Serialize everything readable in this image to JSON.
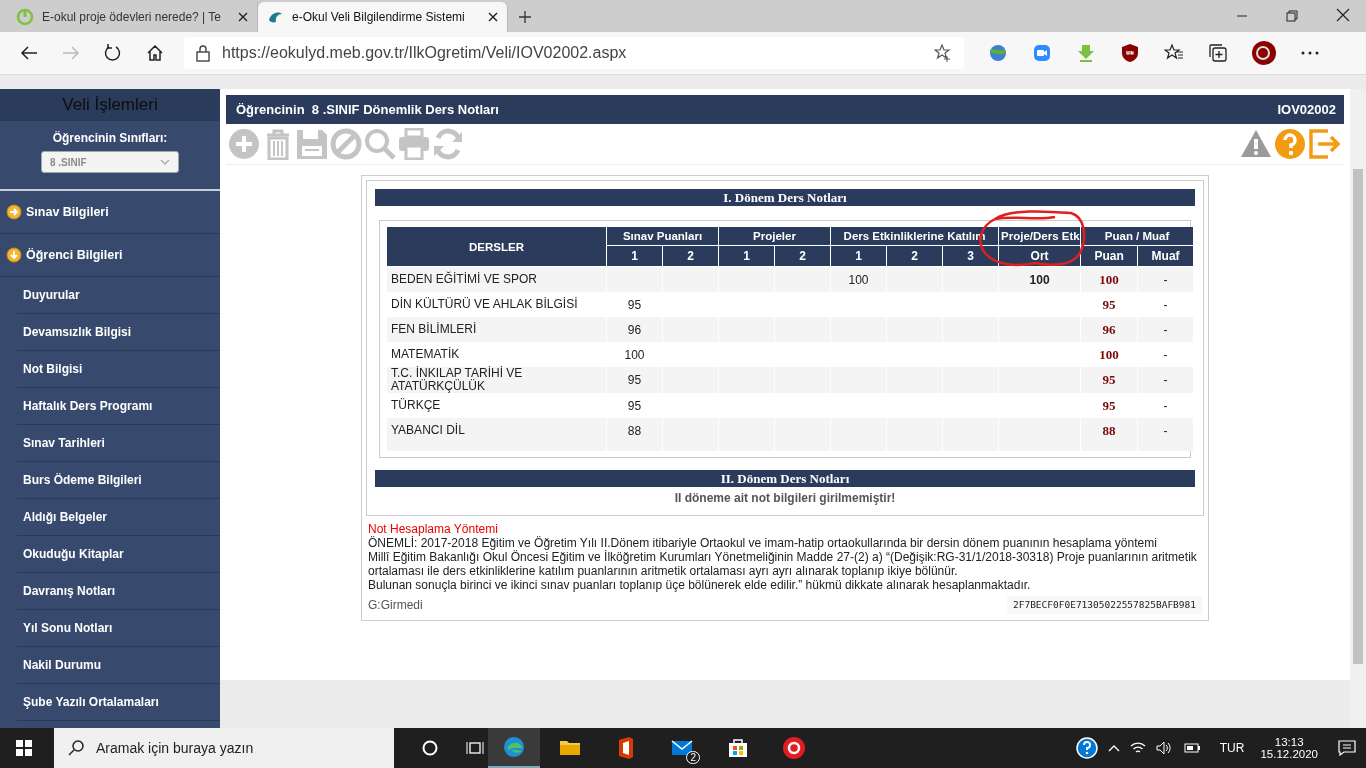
{
  "browser": {
    "tabs": [
      {
        "title": "E-okul proje ödevleri nerede? | Te",
        "selected": false
      },
      {
        "title": "e-Okul Veli Bilgilendirme Sistemi",
        "selected": true
      }
    ],
    "url": "https://eokulyd.meb.gov.tr/IlkOgretim/Veli/IOV02002.aspx"
  },
  "sidebar": {
    "title": "Veli İşlemleri",
    "class_label": "Öğrencinin Sınıfları:",
    "class_select": {
      "value": "8 .SINIF",
      "disabled": true
    },
    "items": [
      {
        "label": "Sınav Bilgileri",
        "kind": "section",
        "expanded": false
      },
      {
        "label": "Öğrenci Bilgileri",
        "kind": "section",
        "expanded": true
      },
      {
        "label": "Duyurular",
        "kind": "link"
      },
      {
        "label": "Devamsızlık Bilgisi",
        "kind": "link"
      },
      {
        "label": "Not Bilgisi",
        "kind": "link"
      },
      {
        "label": "Haftalık Ders Programı",
        "kind": "link"
      },
      {
        "label": "Sınav Tarihleri",
        "kind": "link"
      },
      {
        "label": "Burs Ödeme Bilgileri",
        "kind": "link"
      },
      {
        "label": "Aldığı Belgeler",
        "kind": "link"
      },
      {
        "label": "Okuduğu Kitaplar",
        "kind": "link"
      },
      {
        "label": "Davranış Notları",
        "kind": "link"
      },
      {
        "label": "Yıl Sonu Notları",
        "kind": "link"
      },
      {
        "label": "Nakil Durumu",
        "kind": "link"
      },
      {
        "label": "Şube Yazılı Ortalamaları",
        "kind": "link"
      }
    ]
  },
  "page": {
    "title": "Öğrencinin  8 .SINIF Dönemlik Ders Notları",
    "code": "IOV02002"
  },
  "term1": {
    "title": "I. Dönem Ders Notları",
    "groups": [
      "DERSLER",
      "Sınav Puanları",
      "Projeler",
      "Ders Etkinliklerine Katılım",
      "Proje/Ders Etk",
      "Puan / Muaf"
    ],
    "subheaders": [
      "1",
      "2",
      "1",
      "2",
      "1",
      "2",
      "3",
      "Ort",
      "Puan",
      "Muaf"
    ],
    "rows": [
      {
        "course": "BEDEN EĞİTİMİ VE SPOR",
        "activity_1": "100",
        "average": "100",
        "puan": "100",
        "muaf": "-"
      },
      {
        "course": "DİN KÜLTÜRÜ VE AHLAK BİLGİSİ",
        "exam_1": "95",
        "puan": "95",
        "muaf": "-"
      },
      {
        "course": "FEN BİLİMLERİ",
        "exam_1": "96",
        "puan": "96",
        "muaf": "-"
      },
      {
        "course": "MATEMATİK",
        "exam_1": "100",
        "puan": "100",
        "muaf": "-"
      },
      {
        "course": "T.C. İNKILAP TARİHİ VE ATATÜRKÇÜLÜK",
        "exam_1": "95",
        "puan": "95",
        "muaf": "-"
      },
      {
        "course": "TÜRKÇE",
        "exam_1": "95",
        "puan": "95",
        "muaf": "-"
      },
      {
        "course": "YABANCI DİL",
        "exam_1": "88",
        "puan": "88",
        "muaf": "-"
      }
    ]
  },
  "term2": {
    "title": "II. Dönem Ders Notları",
    "message": "II döneme ait not bilgileri girilmemiştir!"
  },
  "notes": {
    "heading": "Not Hesaplama Yöntemi",
    "lines": [
      "ÖNEMLİ: 2017-2018 Eğitim ve Öğretim Yılı II.Dönem itibariyle Ortaokul ve imam-hatip ortaokullarında bir dersin dönem puanının hesaplama yöntemi",
      "Millî Eğitim Bakanlığı Okul Öncesi Eğitim ve İlköğretim Kurumları Yönetmeliğinin Madde 27-(2) a) “(Değişik:RG-31/1/2018-30318) Proje puanlarının aritmetik ortalaması ile ders etkinliklerine katılım puanlarının aritmetik ortalaması ayrı ayrı alınarak toplanıp ikiye bölünür.",
      "Bulunan sonuçla birinci ve ikinci sınav puanları toplanıp üçe bölünerek elde edilir.” hükmü dikkate alınarak hesaplanmaktadır."
    ],
    "legend": "G:Girmedi",
    "hash": "2F7BECF0F0E71305022557825BAFB981"
  },
  "taskbar": {
    "search_placeholder": "Aramak için buraya yazın",
    "mail_badge": "2",
    "language": "TUR",
    "time": "13:13",
    "date": "15.12.2020"
  }
}
